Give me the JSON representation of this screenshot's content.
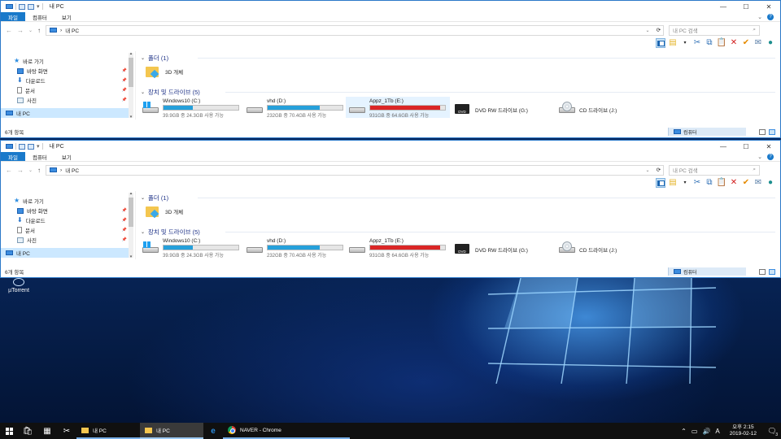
{
  "window": {
    "title": "내 PC",
    "tabs": [
      "파일",
      "컴퓨터",
      "보기"
    ],
    "address_path": "내 PC",
    "search_placeholder": "내 PC 검색",
    "win_controls": [
      "—",
      "☐",
      "✕"
    ]
  },
  "toolbar_icons": [
    "layout-pane-icon",
    "new-folder-icon",
    "cut-icon",
    "copy-icon",
    "paste-icon",
    "delete-icon",
    "checkmark-icon",
    "email-icon",
    "globe-icon"
  ],
  "nav_pane": {
    "quick_access": "바로 가기",
    "items": [
      {
        "label": "바탕 화면",
        "icon": "desktop-icon"
      },
      {
        "label": "다운로드",
        "icon": "download-icon"
      },
      {
        "label": "문서",
        "icon": "document-icon"
      },
      {
        "label": "사진",
        "icon": "pictures-icon"
      }
    ],
    "this_pc": "내 PC"
  },
  "groups": {
    "folders": "폴더 (1)",
    "drives": "장치 및 드라이브 (5)"
  },
  "folders": [
    {
      "name": "3D 개체"
    }
  ],
  "drives": [
    {
      "name": "Windows10 (C:)",
      "usage_fraction": 0.39,
      "free_text": "39.9GB 중 24.3GB 사용 가능",
      "kind": "windows",
      "full": false
    },
    {
      "name": "vhd (D:)",
      "usage_fraction": 0.7,
      "free_text": "232GB 중 70.4GB 사용 가능",
      "kind": "hdd",
      "full": false
    },
    {
      "name": "Appz_1Tb (E:)",
      "usage_fraction": 0.93,
      "free_text": "931GB 중 64.6GB 사용 가능",
      "kind": "hdd",
      "full": true
    },
    {
      "name": "DVD RW 드라이브 (G:)",
      "kind": "dvd"
    },
    {
      "name": "CD 드라이브 (J:)",
      "kind": "cd"
    }
  ],
  "status": {
    "item_count": "6개 항목",
    "computer_tag": "컴퓨터"
  },
  "desktop": {
    "icons": [
      {
        "label": "µTorrent"
      }
    ]
  },
  "taskbar": {
    "pinned": [
      "store-icon",
      "calculator-icon",
      "snip-icon"
    ],
    "buttons": [
      {
        "label": "내 PC",
        "state": "run"
      },
      {
        "label": "내 PC",
        "state": "active"
      },
      {
        "label": "NAVER - Chrome",
        "state": "run"
      }
    ],
    "ie_icon": "ie-icon",
    "tray_ime": "A",
    "clock_time": "오후 2:15",
    "clock_date": "2019-02-12",
    "notification_count": "3"
  }
}
